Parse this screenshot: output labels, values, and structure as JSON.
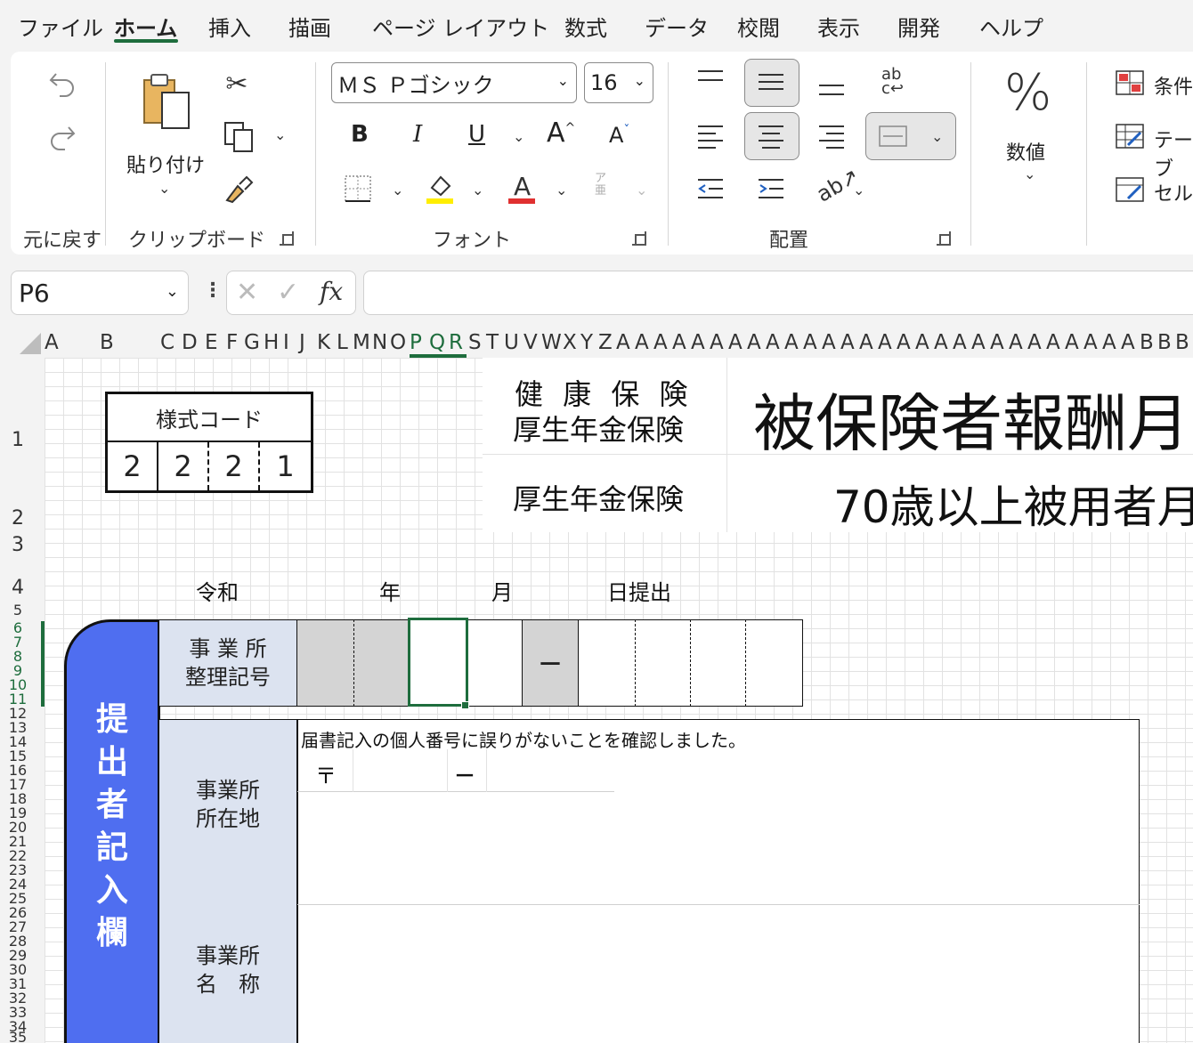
{
  "tabs": [
    "ファイル",
    "ホーム",
    "挿入",
    "描画",
    "ページ レイアウト",
    "数式",
    "データ",
    "校閲",
    "表示",
    "開発",
    "ヘルプ"
  ],
  "active_tab": "ホーム",
  "ribbon": {
    "undo_group_label": "元に戻す",
    "clipboard": {
      "paste_label": "貼り付け",
      "group_label": "クリップボード"
    },
    "font": {
      "name": "ＭＳ Ｐゴシック",
      "size": "16",
      "group_label": "フォント",
      "bold": "B",
      "italic": "I",
      "underline": "U",
      "grow": "A",
      "shrink": "A",
      "phonetic": "ア亜"
    },
    "alignment": {
      "group_label": "配置"
    },
    "number": {
      "label": "数値",
      "symbol": "%"
    },
    "styles": {
      "conditional": "条件",
      "table": "テーブ",
      "cell": "セル"
    }
  },
  "name_box": "P6",
  "fx": "fx",
  "columns": [
    "A",
    "B",
    "C",
    "D",
    "E",
    "F",
    "G",
    "H",
    "I",
    "J",
    "K",
    "L",
    "M",
    "N",
    "O",
    "P",
    "Q",
    "R",
    "S",
    "T",
    "U",
    "V",
    "W",
    "X",
    "Y",
    "Z",
    "A",
    "A",
    "A",
    "A",
    "A",
    "A",
    "A",
    "A",
    "A",
    "A",
    "A",
    "A",
    "A",
    "A",
    "A",
    "A",
    "A",
    "A",
    "A",
    "A",
    "A",
    "A",
    "A",
    "A",
    "A",
    "A",
    "A",
    "A",
    "B",
    "B",
    "B",
    "B",
    "B"
  ],
  "rows": [
    "1",
    "2",
    "3",
    "4",
    "5",
    "6",
    "7",
    "8",
    "9",
    "10",
    "11",
    "12",
    "13",
    "14",
    "15",
    "16",
    "17",
    "18",
    "19",
    "20",
    "21",
    "22",
    "23",
    "24",
    "25",
    "26",
    "27",
    "28",
    "29",
    "30",
    "31",
    "32",
    "33",
    "34",
    "35"
  ],
  "form": {
    "form_code_label": "様式コード",
    "form_code_digits": [
      "2",
      "2",
      "2",
      "1"
    ],
    "insurance_line1": "健 康 保 険",
    "insurance_line2": "厚生年金保険",
    "insurance_line3": "厚生年金保険",
    "title_main": "被保険者報酬月",
    "title_sub": "70歳以上被用者月",
    "date_era": "令和",
    "date_year": "年",
    "date_month": "月",
    "date_day": "日提出",
    "office_number_label_1": "事 業 所",
    "office_number_label_2": "整理記号",
    "dash": "－",
    "confirm_text": "届書記入の個人番号に誤りがないことを確認しました。",
    "postal_mark": "〒",
    "postal_dash": "－",
    "address_label_1": "事業所",
    "address_label_2": "所在地",
    "name_label_1": "事業所",
    "name_label_2": "名　称",
    "side_label": [
      "提",
      "出",
      "者",
      "記",
      "入",
      "欄"
    ]
  },
  "colors": {
    "accent": "#1e6d3d",
    "side_blue": "#4f6ef0",
    "label_bg": "#dce3f0",
    "gray_cell": "#d4d4d4"
  }
}
